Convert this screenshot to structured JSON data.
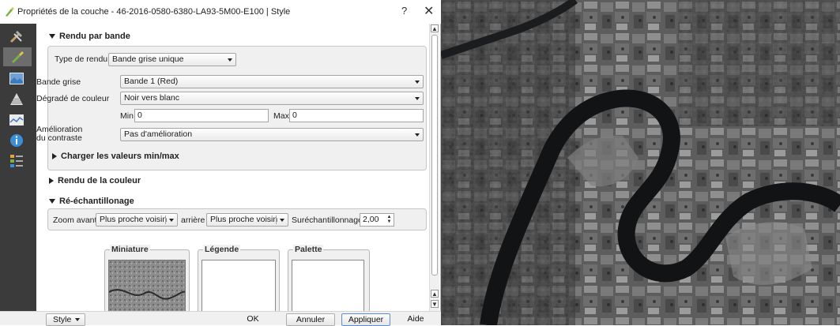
{
  "window": {
    "title": "Propriétés de la couche - 46-2016-0580-6380-LA93-5M00-E100 | Style",
    "help_label": "?",
    "close_label": "✕"
  },
  "tabs": [
    {
      "icon": "tools-icon"
    },
    {
      "icon": "style-brush-icon",
      "active": true
    },
    {
      "icon": "transparency-icon"
    },
    {
      "icon": "pyramids-icon"
    },
    {
      "icon": "histogram-icon"
    },
    {
      "icon": "info-icon"
    },
    {
      "icon": "legend-icon"
    }
  ],
  "render_band": {
    "header": "Rendu par bande",
    "render_type_label": "Type de rendu",
    "render_type_value": "Bande grise unique",
    "gray_band_label": "Bande grise",
    "gray_band_value": "Bande 1 (Red)",
    "gradient_label": "Dégradé de couleur",
    "gradient_value": "Noir vers blanc",
    "min_label": "Min",
    "min_value": "0",
    "max_label": "Max",
    "max_value": "0",
    "contrast_label_1": "Amélioration",
    "contrast_label_2": "du contraste",
    "contrast_value": "Pas d'amélioration",
    "load_minmax_label": "Charger les valeurs min/max"
  },
  "color_render": {
    "header": "Rendu de la couleur"
  },
  "resampling": {
    "header": "Ré-échantillonage",
    "zoom_in_label": "Zoom avant",
    "zoom_in_value": "Plus proche voisin",
    "zoom_out_label": "arrière",
    "zoom_out_value": "Plus proche voisin",
    "oversampling_label": "Suréchantillonnage",
    "oversampling_value": "2,00"
  },
  "previews": {
    "thumbnail_label": "Miniature",
    "legend_label": "Légende",
    "palette_label": "Palette"
  },
  "footer": {
    "style_label": "Style",
    "ok_label": "OK",
    "cancel_label": "Annuler",
    "apply_label": "Appliquer",
    "help_label": "Aide"
  },
  "colors": {
    "tab_bar_bg": "#3b3b3b",
    "group_bg": "#f0f0f0",
    "river": "#101214"
  }
}
